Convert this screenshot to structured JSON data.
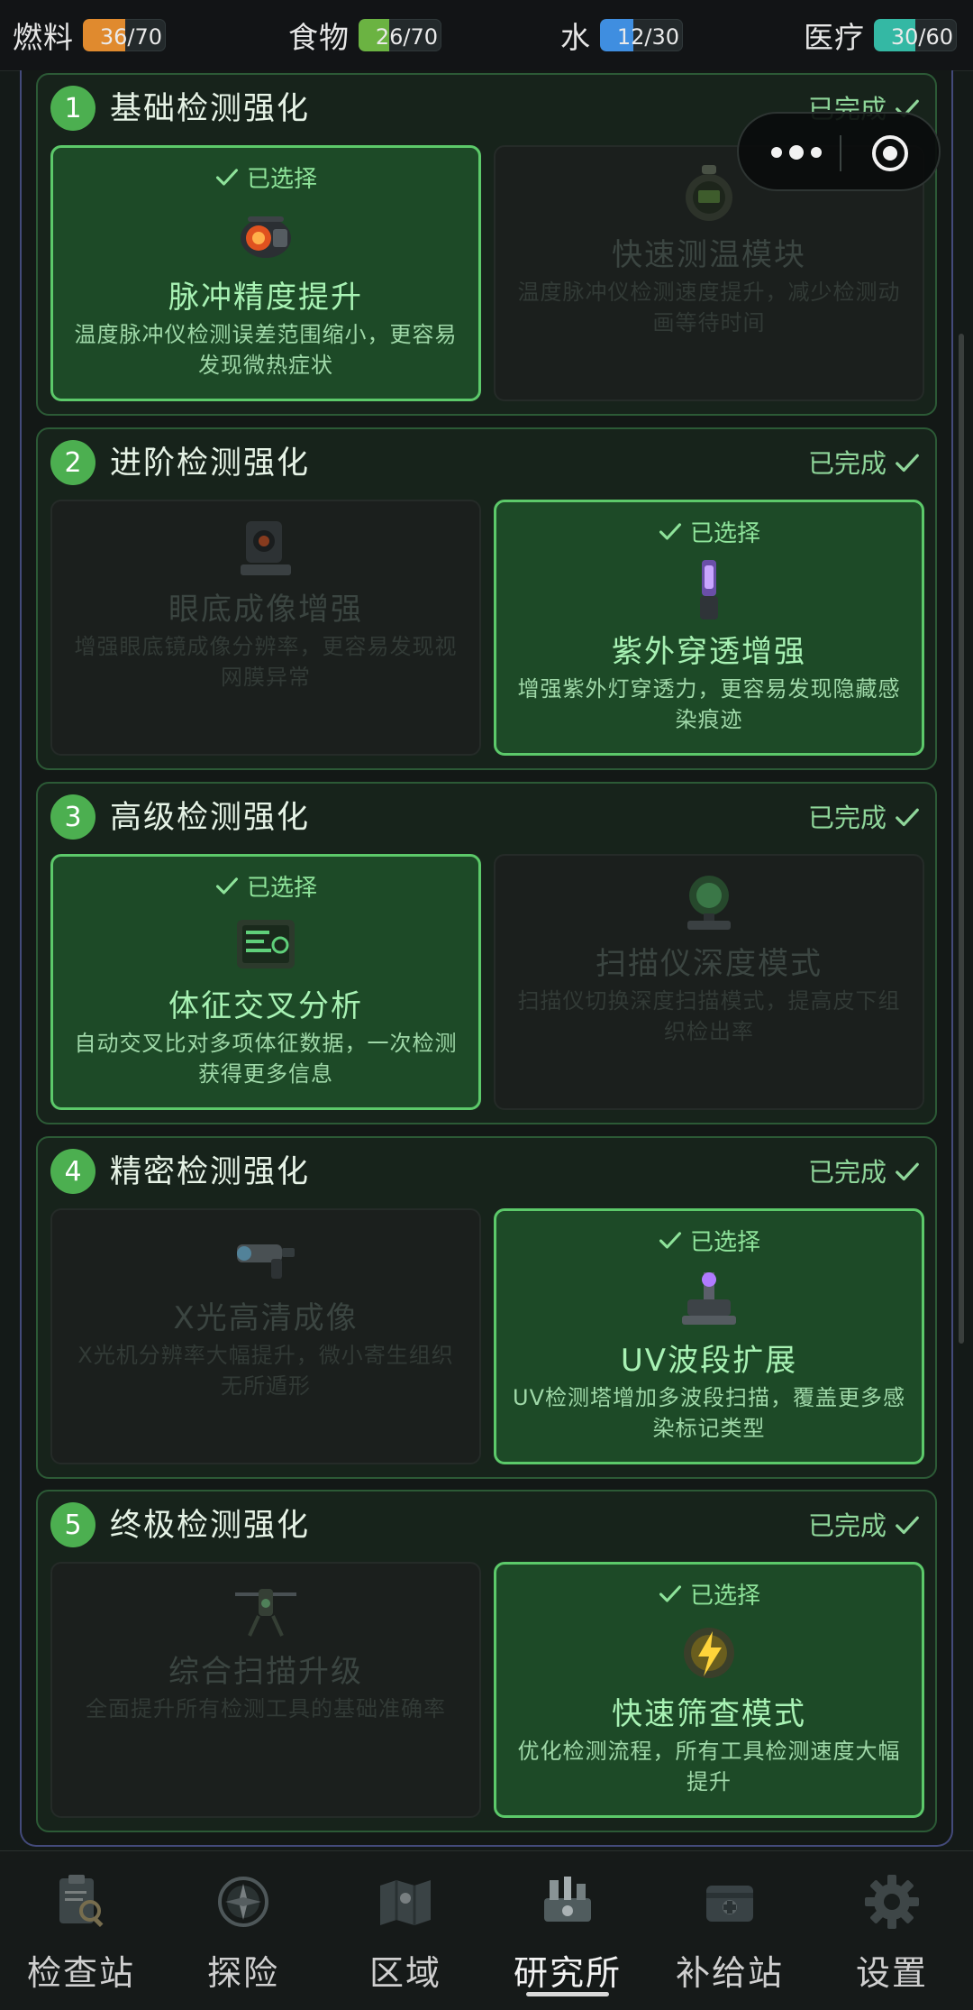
{
  "resources": [
    {
      "label": "燃料",
      "value": "36/70",
      "fill": 0.514,
      "color": "#e08a2e"
    },
    {
      "label": "食物",
      "value": "26/70",
      "fill": 0.371,
      "color": "#6bb342"
    },
    {
      "label": "水",
      "value": "12/30",
      "fill": 0.4,
      "color": "#3f8ee0"
    },
    {
      "label": "医疗",
      "value": "30/60",
      "fill": 0.5,
      "color": "#34b8a4"
    }
  ],
  "capsule": {
    "more_icon": "more-dots-icon",
    "close_icon": "target-circle-icon"
  },
  "selected_label": "已选择",
  "tiers": [
    {
      "number": "1",
      "title": "基础检测强化",
      "status": "已完成",
      "options": [
        {
          "name": "脉冲精度提升",
          "desc": "温度脉冲仪检测误差范围缩小，更容易发现微热症状",
          "selected": true,
          "icon": "pulse-device-icon"
        },
        {
          "name": "快速测温模块",
          "desc": "温度脉冲仪检测速度提升，减少检测动画等待时间",
          "selected": false,
          "icon": "stopwatch-icon"
        }
      ]
    },
    {
      "number": "2",
      "title": "进阶检测强化",
      "status": "已完成",
      "options": [
        {
          "name": "眼底成像增强",
          "desc": "增强眼底镜成像分辨率，更容易发现视网膜异常",
          "selected": false,
          "icon": "retina-scanner-icon"
        },
        {
          "name": "紫外穿透增强",
          "desc": "增强紫外灯穿透力，更容易发现隐藏感染痕迹",
          "selected": true,
          "icon": "uv-lamp-icon"
        }
      ]
    },
    {
      "number": "3",
      "title": "高级检测强化",
      "status": "已完成",
      "options": [
        {
          "name": "体征交叉分析",
          "desc": "自动交叉比对多项体征数据，一次检测获得更多信息",
          "selected": true,
          "icon": "data-panel-icon"
        },
        {
          "name": "扫描仪深度模式",
          "desc": "扫描仪切换深度扫描模式，提高皮下组织检出率",
          "selected": false,
          "icon": "radar-scanner-icon"
        }
      ]
    },
    {
      "number": "4",
      "title": "精密检测强化",
      "status": "已完成",
      "options": [
        {
          "name": "X光高清成像",
          "desc": "X光机分辨率大幅提升，微小寄生组织无所遁形",
          "selected": false,
          "icon": "xray-gun-icon"
        },
        {
          "name": "UV波段扩展",
          "desc": "UV检测塔增加多波段扫描，覆盖更多感染标记类型",
          "selected": true,
          "icon": "uv-tower-icon"
        }
      ]
    },
    {
      "number": "5",
      "title": "终极检测强化",
      "status": "已完成",
      "options": [
        {
          "name": "综合扫描升级",
          "desc": "全面提升所有检测工具的基础准确率",
          "selected": false,
          "icon": "drone-scanner-icon"
        },
        {
          "name": "快速筛查模式",
          "desc": "优化检测流程，所有工具检测速度大幅提升",
          "selected": true,
          "icon": "lightning-shield-icon"
        }
      ]
    }
  ],
  "nav": [
    {
      "label": "检查站",
      "icon": "clipboard-search-icon",
      "active": false
    },
    {
      "label": "探险",
      "icon": "compass-icon",
      "active": false
    },
    {
      "label": "区域",
      "icon": "map-icon",
      "active": false
    },
    {
      "label": "研究所",
      "icon": "lab-icon",
      "active": true
    },
    {
      "label": "补给站",
      "icon": "supply-crate-icon",
      "active": false
    },
    {
      "label": "设置",
      "icon": "gear-icon",
      "active": false
    }
  ]
}
